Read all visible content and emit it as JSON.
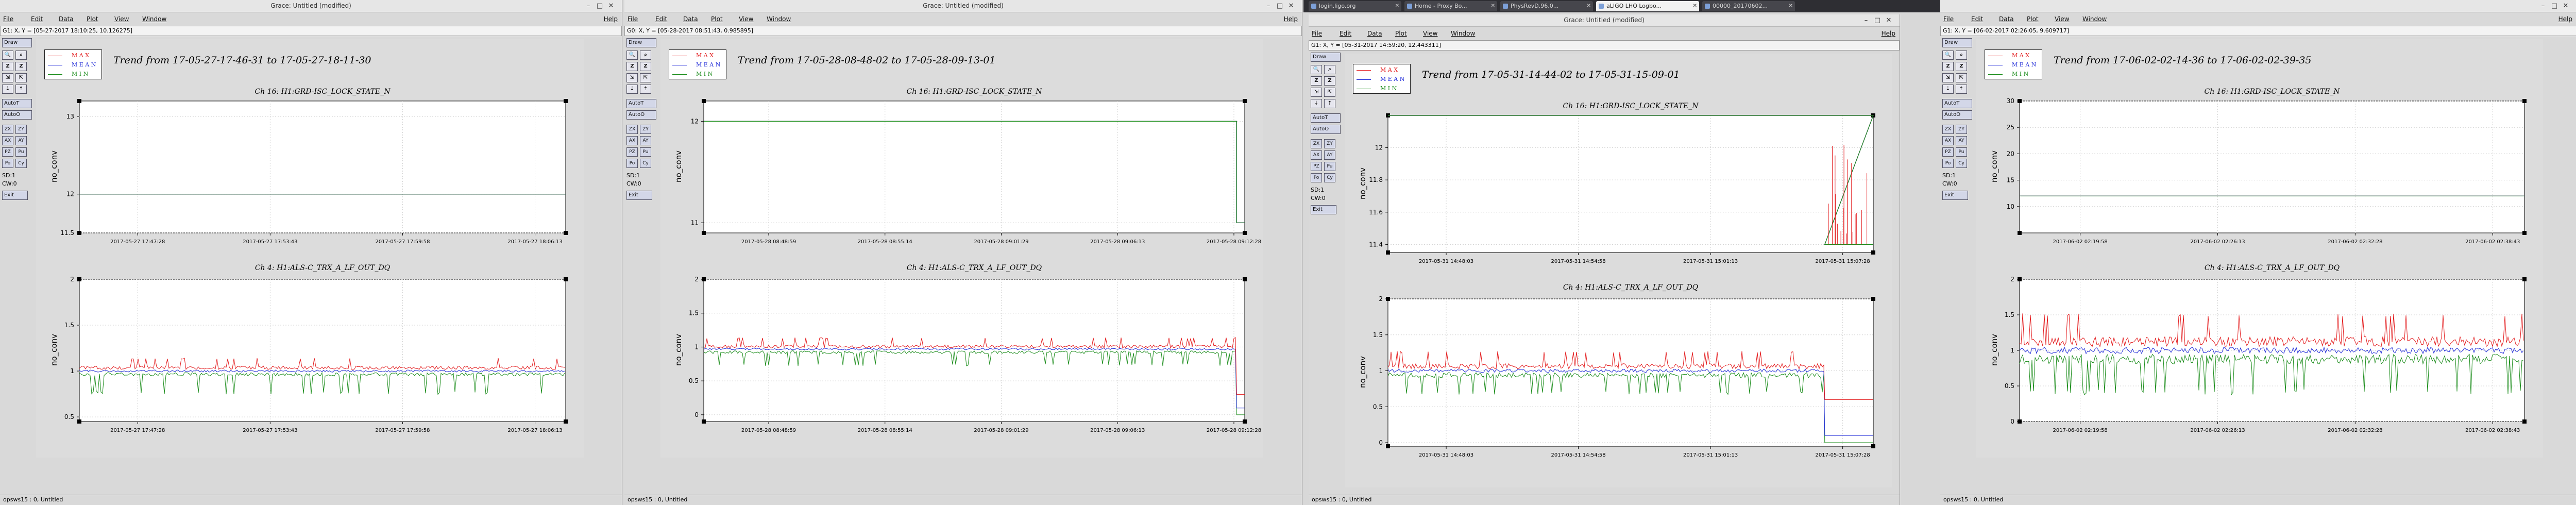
{
  "windows": [
    {
      "id": "w1",
      "title": "Grace: Untitled (modified)",
      "menu": [
        "File",
        "Edit",
        "Data",
        "Plot",
        "View",
        "Window"
      ],
      "help": "Help",
      "locator": "G1: X, Y = [05-27-2017 18:10:25, 10.126275]",
      "trend_title": "Trend from 17-05-27-17-46-31 to 17-05-27-18-11-30",
      "status": "opsws15 : 0, Untitled"
    },
    {
      "id": "w2",
      "title": "Grace: Untitled (modified)",
      "menu": [
        "File",
        "Edit",
        "Data",
        "Plot",
        "View",
        "Window"
      ],
      "help": "Help",
      "locator": "G0: X, Y = [05-28-2017 08:51:43, 0.985895]",
      "trend_title": "Trend from 17-05-28-08-48-02 to 17-05-28-09-13-01",
      "status": "opsws15 : 0, Untitled"
    },
    {
      "id": "w3",
      "title": "Grace: Untitled (modified)",
      "menu": [
        "File",
        "Edit",
        "Data",
        "Plot",
        "View",
        "Window"
      ],
      "help": "Help",
      "locator": "G1: X, Y = [05-31-2017 14:59:20, 12.443311]",
      "trend_title": "Trend from 17-05-31-14-44-02 to 17-05-31-15-09-01",
      "status": "opsws15 : 0, Untitled"
    },
    {
      "id": "w4",
      "title": "",
      "menu": [
        "File",
        "Edit",
        "Data",
        "Plot",
        "View",
        "Window"
      ],
      "help": "Help",
      "locator": "G1: X, Y = [06-02-2017 02:26:05, 9.609717]",
      "trend_title": "Trend from 17-06-02-02-14-36 to 17-06-02-02-39-35",
      "status": "opsws15 : 0, Untitled"
    }
  ],
  "toolbar": {
    "draw": "Draw",
    "autot": "AutoT",
    "autoo": "AutoO",
    "zx": "ZX",
    "zy": "ZY",
    "ax": "AX",
    "ay": "AY",
    "pz": "PZ",
    "pu": "Pu",
    "po": "Po",
    "cy": "Cy",
    "sd": "SD:1",
    "cw": "CW:0",
    "exit": "Exit"
  },
  "legend": [
    "M A X",
    "M E A N",
    "M I N"
  ],
  "ch16_title": "Ch 16: H1:GRD-ISC_LOCK_STATE_N",
  "ch4_title": "Ch 4: H1:ALS-C_TRX_A_LF_OUT_DQ",
  "ylabel": "no_conv",
  "browser_tabs": [
    "login.ligo.org",
    "Home - Proxy Bo...",
    "PhysRevD.96.0...",
    "aLIGO LHO Logbo...",
    "00000_20170602..."
  ],
  "colors": {
    "max": "#e31a1c",
    "mean": "#1f2ad8",
    "min": "#1a8c1a"
  },
  "chart_data": [
    {
      "type": "line",
      "title": "Ch 16: H1:GRD-ISC_LOCK_STATE_N",
      "ylabel": "no_conv",
      "ylim": [
        11.5,
        13.2
      ],
      "yticks": [
        11.5,
        12,
        13
      ],
      "xticks": [
        "2017-05-27 17:47:28",
        "2017-05-27 17:53:43",
        "2017-05-27 17:59:58",
        "2017-05-27 18:06:13"
      ],
      "series": [
        {
          "name": "M A X",
          "values": [
            12,
            12
          ]
        },
        {
          "name": "M E A N",
          "values": [
            12,
            12
          ]
        },
        {
          "name": "M I N",
          "values": [
            12,
            12
          ]
        }
      ]
    },
    {
      "type": "line",
      "title": "Ch 4: H1:ALS-C_TRX_A_LF_OUT_DQ",
      "ylabel": "no_conv",
      "ylim": [
        0.45,
        2
      ],
      "yticks": [
        0.5,
        1,
        1.5,
        2
      ],
      "xticks": [
        "2017-05-27 17:47:28",
        "2017-05-27 17:53:43",
        "2017-05-27 17:59:58",
        "2017-05-27 18:06:13"
      ],
      "series": [
        {
          "name": "M A X",
          "values": [
            1.03,
            1.03
          ]
        },
        {
          "name": "M E A N",
          "values": [
            1.0,
            1.0
          ]
        },
        {
          "name": "M I N",
          "values": [
            0.97,
            0.6
          ]
        }
      ]
    },
    {
      "type": "line",
      "title": "Ch 16: H1:GRD-ISC_LOCK_STATE_N",
      "ylabel": "no_conv",
      "ylim": [
        10.9,
        12.2
      ],
      "yticks": [
        11,
        12
      ],
      "xticks": [
        "2017-05-28 08:48:59",
        "2017-05-28 08:55:14",
        "2017-05-28 09:01:29",
        "2017-05-28 09:06:13",
        "2017-05-28 09:12:28"
      ],
      "series": [
        {
          "name": "M A X",
          "values": [
            12,
            12,
            11
          ]
        },
        {
          "name": "M E A N",
          "values": [
            12,
            12,
            11
          ]
        },
        {
          "name": "M I N",
          "values": [
            12,
            12,
            11
          ]
        }
      ]
    },
    {
      "type": "line",
      "title": "Ch 4: H1:ALS-C_TRX_A_LF_OUT_DQ",
      "ylabel": "no_conv",
      "ylim": [
        -0.1,
        2
      ],
      "yticks": [
        0,
        0.5,
        1,
        1.5,
        2
      ],
      "xticks": [
        "2017-05-28 08:48:59",
        "2017-05-28 08:55:14",
        "2017-05-28 09:01:29",
        "2017-05-28 09:06:13",
        "2017-05-28 09:12:28"
      ],
      "series": [
        {
          "name": "M A X",
          "values": [
            1.0,
            1.0,
            0.3
          ]
        },
        {
          "name": "M E A N",
          "values": [
            0.97,
            0.97,
            0.1
          ]
        },
        {
          "name": "M I N",
          "values": [
            0.93,
            0.9,
            0.0
          ]
        }
      ]
    },
    {
      "type": "line",
      "title": "Ch 16: H1:GRD-ISC_LOCK_STATE_N",
      "ylabel": "no_conv",
      "ylim": [
        11.35,
        12.2
      ],
      "yticks": [
        11.4,
        11.6,
        11.8,
        12
      ],
      "xticks": [
        "2017-05-31 14:48:03",
        "2017-05-31 14:54:58",
        "2017-05-31 15:01:13",
        "2017-05-31 15:07:28"
      ],
      "series": [
        {
          "name": "M A X",
          "values": [
            12.2,
            12.2,
            11.4
          ]
        },
        {
          "name": "M E A N",
          "values": [
            12.2,
            12.2,
            11.4
          ]
        },
        {
          "name": "M I N",
          "values": [
            12.2,
            12.2,
            11.4
          ]
        }
      ]
    },
    {
      "type": "line",
      "title": "Ch 4: H1:ALS-C_TRX_A_LF_OUT_DQ",
      "ylabel": "no_conv",
      "ylim": [
        -0.05,
        2
      ],
      "yticks": [
        0,
        0.5,
        1,
        1.5,
        2
      ],
      "xticks": [
        "2017-05-31 14:48:03",
        "2017-05-31 14:54:58",
        "2017-05-31 15:01:13",
        "2017-05-31 15:07:28"
      ],
      "series": [
        {
          "name": "M A X",
          "values": [
            1.05,
            1.05,
            0.6
          ]
        },
        {
          "name": "M E A N",
          "values": [
            1.0,
            1.0,
            0.1
          ]
        },
        {
          "name": "M I N",
          "values": [
            0.95,
            0.9,
            0.0
          ]
        }
      ]
    },
    {
      "type": "line",
      "title": "Ch 16: H1:GRD-ISC_LOCK_STATE_N",
      "ylabel": "no_conv",
      "ylim": [
        5,
        30
      ],
      "yticks": [
        10,
        15,
        20,
        25,
        30
      ],
      "xticks": [
        "2017-06-02 02:19:58",
        "2017-06-02 02:26:13",
        "2017-06-02 02:32:28",
        "2017-06-02 02:38:43"
      ],
      "series": [
        {
          "name": "M A X",
          "values": [
            12,
            12
          ]
        },
        {
          "name": "M E A N",
          "values": [
            12,
            12
          ]
        },
        {
          "name": "M I N",
          "values": [
            12,
            12
          ]
        }
      ]
    },
    {
      "type": "line",
      "title": "Ch 4: H1:ALS-C_TRX_A_LF_OUT_DQ",
      "ylabel": "no_conv",
      "ylim": [
        0,
        2
      ],
      "yticks": [
        0,
        0.5,
        1,
        1.5,
        2
      ],
      "xticks": [
        "2017-06-02 02:19:58",
        "2017-06-02 02:26:13",
        "2017-06-02 02:32:28",
        "2017-06-02 02:38:43"
      ],
      "series": [
        {
          "name": "M A X",
          "values": [
            1.1,
            1.1
          ]
        },
        {
          "name": "M E A N",
          "values": [
            1.0,
            1.0
          ]
        },
        {
          "name": "M I N",
          "values": [
            0.9,
            0.2
          ]
        }
      ]
    }
  ]
}
